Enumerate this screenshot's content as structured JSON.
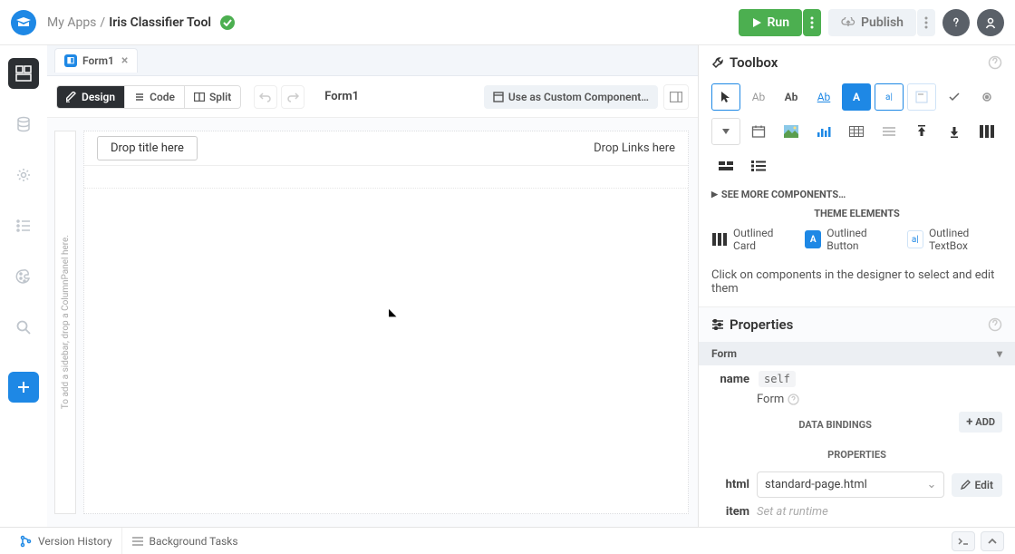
{
  "header": {
    "breadcrumb_root": "My Apps",
    "breadcrumb_sep": "/",
    "breadcrumb_current": "Iris Classifier Tool",
    "run_label": "Run",
    "publish_label": "Publish"
  },
  "tabs": {
    "form_tab": "Form1"
  },
  "toolbar": {
    "design": "Design",
    "code": "Code",
    "split": "Split",
    "form_name": "Form1",
    "use_component": "Use as Custom Component…"
  },
  "canvas": {
    "sidebar_hint": "To add a sidebar, drop a ColumnPanel here.",
    "drop_title": "Drop title here",
    "drop_links": "Drop Links here"
  },
  "toolbox": {
    "title": "Toolbox",
    "see_more": "SEE MORE COMPONENTS…",
    "theme_head": "THEME ELEMENTS",
    "outlined_card": "Outlined Card",
    "outlined_button": "Outlined Button",
    "outlined_textbox": "Outlined TextBox",
    "hint": "Click on components in the designer to select and edit them"
  },
  "properties": {
    "title": "Properties",
    "type": "Form",
    "name_label": "name",
    "name_value": "self",
    "form_text": "Form",
    "data_bindings": "DATA BINDINGS",
    "add": "ADD",
    "properties_section": "PROPERTIES",
    "html_label": "html",
    "html_value": "standard-page.html",
    "edit": "Edit",
    "item_label": "item",
    "runtime": "Set at runtime"
  },
  "bottom": {
    "version_history": "Version History",
    "background_tasks": "Background Tasks"
  }
}
